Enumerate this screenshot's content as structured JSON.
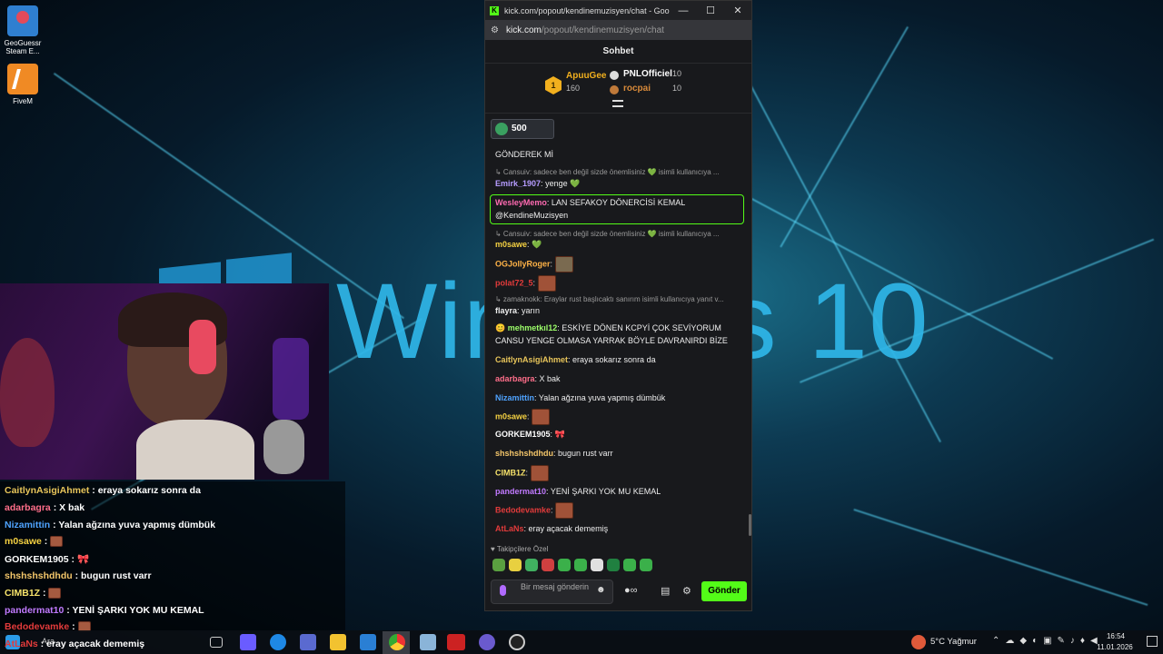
{
  "desktop": {
    "watermark": "Windows 10",
    "icons": [
      {
        "label": "GeoGuessr Steam E...",
        "color": "#2f7fd0"
      },
      {
        "label": "FiveM",
        "color": "#f08a24"
      }
    ]
  },
  "stream_overlay": {
    "lines": [
      {
        "user": "CaitlynAsigiAhmet",
        "sep": " : ",
        "text": "eraya sokarız sonra da",
        "color": "#e8c55a"
      },
      {
        "user": "adarbagra",
        "sep": " : ",
        "text": "X bak",
        "color": "#ff6e8a"
      },
      {
        "user": "Nizamittin",
        "sep": " : ",
        "text": "Yalan ağzına yuva yapmış dümbük",
        "color": "#4fa3ff"
      },
      {
        "user": "m0sawe",
        "sep": " : ",
        "text": "",
        "color": "#f5d142",
        "emote": true
      },
      {
        "user": "GORKEM1905",
        "sep": " : ",
        "text": "",
        "color": "#ffffff",
        "emote": true
      },
      {
        "user": "shshshshdhdu",
        "sep": " : ",
        "text": "bugun rust varr",
        "color": "#f4c66a"
      },
      {
        "user": "CIMB1Z",
        "sep": " : ",
        "text": "",
        "color": "#f7e36a",
        "emote": true
      },
      {
        "user": "pandermat10",
        "sep": " : ",
        "text": "YENİ ŞARKI YOK MU KEMAL",
        "color": "#c17aff"
      },
      {
        "user": "Bedodevamke",
        "sep": " : ",
        "text": "",
        "color": "#e33b3b",
        "emote": true
      },
      {
        "user": "AtLaNs",
        "sep": " : ",
        "text": "eray açacak dememiş",
        "color": "#e33b3b"
      }
    ]
  },
  "browser": {
    "title": "kick.com/popout/kendinemuzisyen/chat - Google...",
    "url_host": "kick.com",
    "url_path": "/popout/kendinemuzisyen/chat",
    "minimize": "—",
    "maximize": "☐",
    "close": "✕"
  },
  "chat": {
    "header": "Sohbet",
    "leaderboard": {
      "rank": "1",
      "first": {
        "name": "ApuuGee",
        "score": "160"
      },
      "second": {
        "name": "PNLOfficiel",
        "score": "10"
      },
      "third": {
        "name": "rocpai",
        "score": "10"
      }
    },
    "pinned_gift": "500",
    "messages": [
      {
        "user": "",
        "text": "GÖNDEREK Mİ",
        "color": "#eee"
      },
      {
        "reply": "↳ Cansuiv: sadece ben değil sizde önemlisiniz 💚 isimli kullanıcıya ..."
      },
      {
        "user": "Emirk_1907",
        "text": "yenge 💚",
        "color": "#b69cff"
      },
      {
        "user": "WesleyMemo",
        "text": "LAN SEFAKOY DÖNERCİSİ KEMAL @KendineMuzisyen",
        "color": "#ff6ab1",
        "highlight": true
      },
      {
        "reply": "↳ Cansuiv: sadece ben değil sizde önemlisiniz 💚 isimli kullanıcıya ..."
      },
      {
        "user": "m0sawe",
        "text": "💚",
        "color": "#f5d142"
      },
      {
        "user": "OGJollyRoger",
        "text": "",
        "color": "#ffb347",
        "emote": true
      },
      {
        "user": "polat72_5",
        "text": "",
        "color": "#e33b3b",
        "emote": true
      },
      {
        "reply": "↳ zamaknokk: Eraylar rust başlıcaktı sanırım isimli kullanıcıya yanıt v..."
      },
      {
        "user": "flayra",
        "text": "yarın",
        "color": "#eee"
      },
      {
        "user": "mehmetkıl12",
        "text": "ESKİYE DÖNEN KCPYİ ÇOK SEVİYORUM CANSU YENGE OLMASA YARRAK BÖYLE DAVRANIRDI BİZE",
        "color": "#9dff6a"
      },
      {
        "user": "CaitlynAsigiAhmet",
        "text": "eraya sokarız sonra da",
        "color": "#e8c55a"
      },
      {
        "user": "adarbagra",
        "text": "X bak",
        "color": "#ff6e8a"
      },
      {
        "user": "Nizamittin",
        "text": "Yalan ağzına yuva yapmış dümbük",
        "color": "#4fa3ff"
      },
      {
        "user": "m0sawe",
        "text": "",
        "color": "#f5d142",
        "emote": true
      },
      {
        "user": "GORKEM1905",
        "text": "",
        "color": "#ffffff",
        "emote": true
      },
      {
        "user": "shshshshdhdu",
        "text": "bugun rust varr",
        "color": "#f4c66a"
      },
      {
        "user": "CIMB1Z",
        "text": "",
        "color": "#f7e36a",
        "emote": true
      },
      {
        "user": "pandermat10",
        "text": "YENİ ŞARKI YOK MU KEMAL",
        "color": "#c17aff"
      },
      {
        "user": "Bedodevamke",
        "text": "",
        "color": "#e33b3b",
        "emote": true
      },
      {
        "user": "AtLaNs",
        "text": "eray açacak dememiş",
        "color": "#e33b3b"
      }
    ],
    "followers_label": "♥ Takipçilere Özel",
    "input_placeholder": "Bir mesaj gönderin",
    "send_label": "Gönder"
  },
  "taskbar": {
    "weather": "5°C  Yağmur",
    "time": "16:54",
    "date": "11.01.2026",
    "search_placeholder": "Ara"
  }
}
